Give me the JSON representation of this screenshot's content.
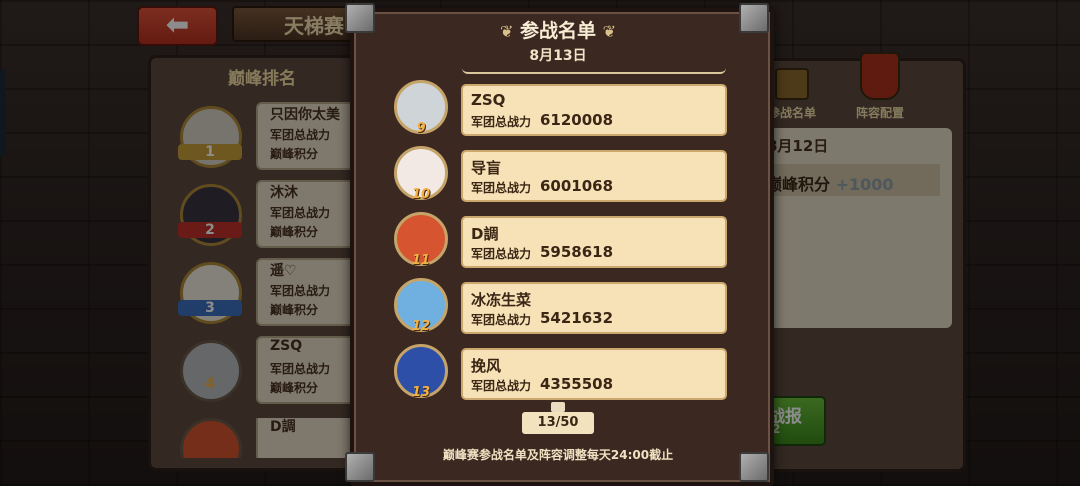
{
  "header": {
    "back_icon": "arrow-left-icon",
    "back_glyph": "⬅",
    "title": "天梯赛"
  },
  "left_panel": {
    "title": "巅峰排名",
    "rows": [
      {
        "rank": "1",
        "name": "只因你太美",
        "power_label": "军团总战力",
        "score_label": "巅峰积分",
        "ribbon": "#c8a13a"
      },
      {
        "rank": "2",
        "name": "沐沐",
        "power_label": "军团总战力",
        "score_label": "巅峰积分",
        "ribbon": "#c2312a"
      },
      {
        "rank": "3",
        "name": "遥♡",
        "power_label": "军团总战力",
        "score_label": "巅峰积分",
        "ribbon": "#3d6fc2"
      },
      {
        "rank": "4",
        "name": "ZSQ",
        "power_label": "军团总战力",
        "score_label": "巅峰积分",
        "ribbon": ""
      },
      {
        "rank": "",
        "name": "D調",
        "power_label": "",
        "score_label": "",
        "ribbon": ""
      }
    ]
  },
  "right_panel": {
    "tabs": [
      {
        "label": "参战名单",
        "icon": "list-icon"
      },
      {
        "label": "阵容配置",
        "icon": "formation-icon"
      }
    ],
    "date": "8月12日",
    "score_label": "巅峰积分",
    "score_delta": "+1000",
    "report_button": {
      "label": "战报",
      "sub": "2"
    }
  },
  "modal": {
    "title": "参战名单",
    "date": "8月13日",
    "entries": [
      {
        "rank": "9",
        "name": "ZSQ",
        "power_label": "军团总战力",
        "power": "6120008",
        "avatar_color": "#cfd4d8"
      },
      {
        "rank": "10",
        "name": "导盲",
        "power_label": "军团总战力",
        "power": "6001068",
        "avatar_color": "#f3e9e4"
      },
      {
        "rank": "11",
        "name": "D調",
        "power_label": "军团总战力",
        "power": "5958618",
        "avatar_color": "#d6542f"
      },
      {
        "rank": "12",
        "name": "冰冻生菜",
        "power_label": "军团总战力",
        "power": "5421632",
        "avatar_color": "#6fb0e0"
      },
      {
        "rank": "13",
        "name": "挽风",
        "power_label": "军团总战力",
        "power": "4355508",
        "avatar_color": "#2d4fa8"
      }
    ],
    "pager": "13/50",
    "footer": "巅峰赛参战名单及阵容调整每天24:00截止"
  }
}
